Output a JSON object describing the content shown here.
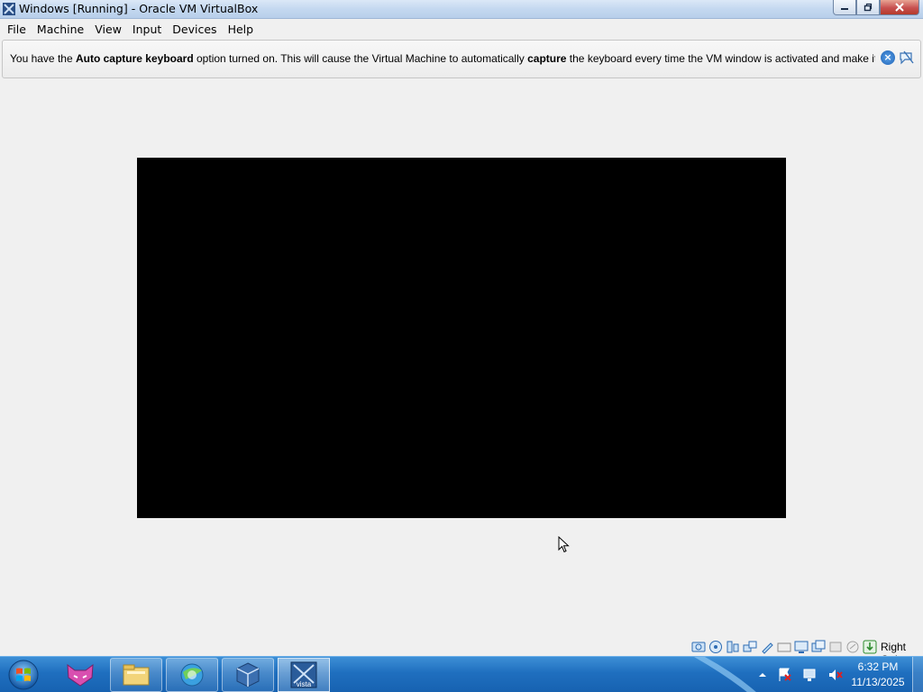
{
  "window": {
    "title": "Windows [Running] - Oracle VM VirtualBox",
    "icons": {
      "app": "virtualbox-icon",
      "minimize": "minimize-icon",
      "restore": "restore-icon",
      "close": "close-icon"
    }
  },
  "menubar": {
    "items": [
      "File",
      "Machine",
      "View",
      "Input",
      "Devices",
      "Help"
    ]
  },
  "banner": {
    "text_1": "You have the ",
    "bold_1": "Auto capture keyboard",
    "text_2": " option turned on. This will cause the Virtual Machine to automatically ",
    "bold_2": "capture",
    "text_3": " the keyboard every time the VM window is activated and make it unavailable to",
    "icons": [
      "close-banner-icon",
      "do-not-show-again-icon"
    ]
  },
  "statusbar": {
    "icons": [
      "hard-disk-icon",
      "optical-drive-icon",
      "audio-icon",
      "network-icon",
      "usb-icon",
      "shared-folders-icon",
      "display-icon",
      "video-capture-icon",
      "guest-additions-icon",
      "cpu-icon",
      "mouse-integration-icon",
      "keyboard-capture-icon"
    ],
    "host_key": "Right Ctrl"
  },
  "taskbar": {
    "start": "windows-start-orb",
    "items": [
      "fox-app-icon",
      "file-explorer-icon",
      "browser-icon",
      "virtualbox-taskbar-icon",
      "vista-vm-icon"
    ],
    "vista_label": "vista",
    "tray_icons": [
      "show-hidden-icons-icon",
      "action-center-icon",
      "network-tray-icon",
      "volume-muted-icon"
    ],
    "clock_time": "6:32 PM",
    "clock_date": "11/13/2025"
  },
  "colors": {
    "vm_screen": "#000000",
    "taskbar": "#1f6fbf",
    "window_bg": "#f0f0f0"
  }
}
